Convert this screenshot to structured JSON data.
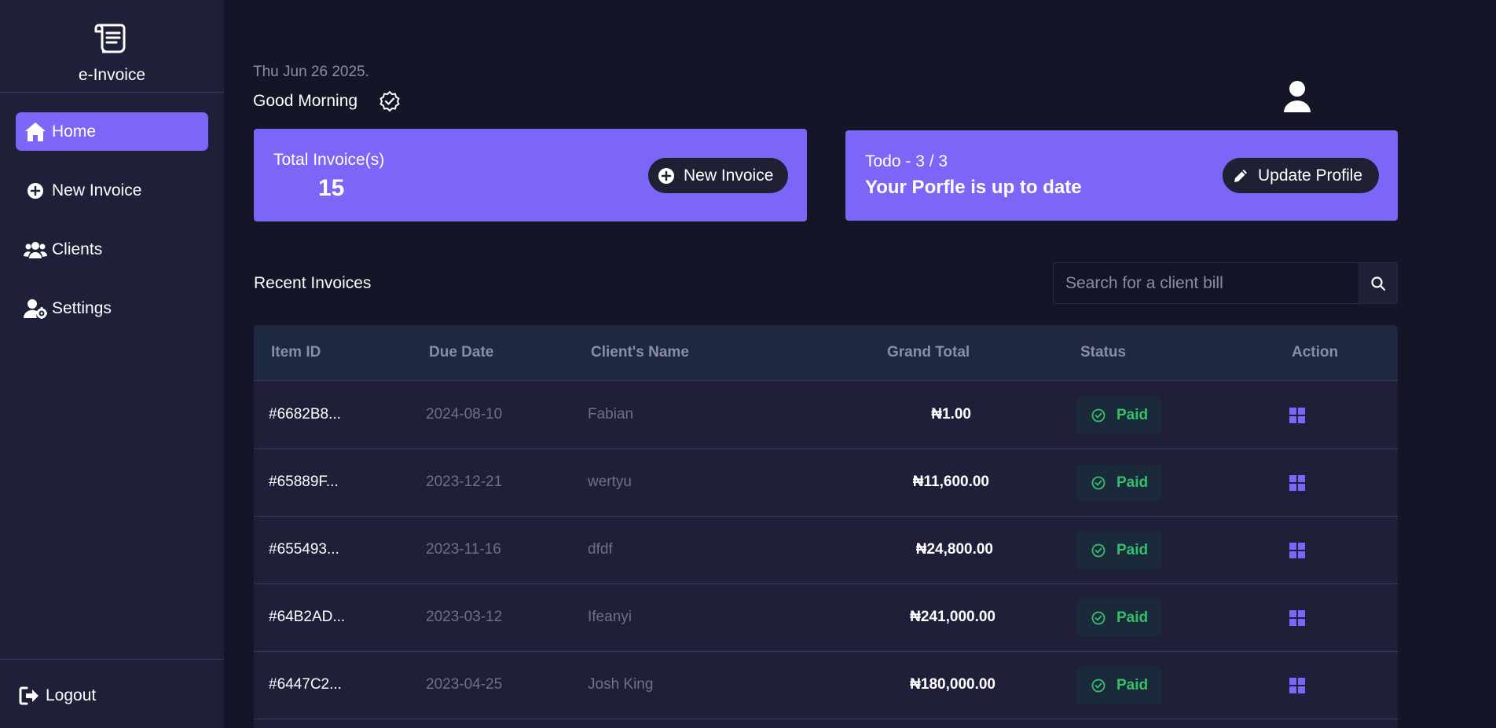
{
  "app": {
    "name": "e-Invoice",
    "brand_icon": "scroll-icon"
  },
  "sidebar": {
    "items": [
      {
        "label": "Home",
        "icon": "home-icon",
        "active": true
      },
      {
        "label": "New Invoice",
        "icon": "plus-circle-icon",
        "active": false
      },
      {
        "label": "Clients",
        "icon": "users-icon",
        "active": false
      },
      {
        "label": "Settings",
        "icon": "user-gear-icon",
        "active": false
      }
    ],
    "logout_label": "Logout"
  },
  "header": {
    "date": "Thu Jun 26 2025.",
    "greeting": "Good Morning"
  },
  "cards": {
    "invoices": {
      "label": "Total Invoice(s)",
      "count": "15",
      "button_label": "New Invoice"
    },
    "todo": {
      "label": "Todo - 3 / 3",
      "message": "Your Porfle is up to date",
      "button_label": "Update Profile"
    }
  },
  "recent": {
    "title": "Recent Invoices",
    "search_placeholder": "Search for a client bill"
  },
  "table": {
    "columns": [
      "Item ID",
      "Due Date",
      "Client's Name",
      "Grand Total",
      "Status",
      "Action"
    ],
    "rows": [
      {
        "id": "#6682B8...",
        "due": "2024-08-10",
        "client": "Fabian",
        "total": "₦1.00",
        "status": "Paid"
      },
      {
        "id": "#65889F...",
        "due": "2023-12-21",
        "client": "wertyu",
        "total": "₦11,600.00",
        "status": "Paid"
      },
      {
        "id": "#655493...",
        "due": "2023-11-16",
        "client": "dfdf",
        "total": "₦24,800.00",
        "status": "Paid"
      },
      {
        "id": "#64B2AD...",
        "due": "2023-03-12",
        "client": "Ifeanyi",
        "total": "₦241,000.00",
        "status": "Paid"
      },
      {
        "id": "#6447C2...",
        "due": "2023-04-25",
        "client": "Josh King",
        "total": "₦180,000.00",
        "status": "Paid"
      }
    ]
  },
  "colors": {
    "accent": "#7c66f8",
    "background": "#141526",
    "sidebar": "#1f1f3a",
    "paid": "#34c069"
  }
}
